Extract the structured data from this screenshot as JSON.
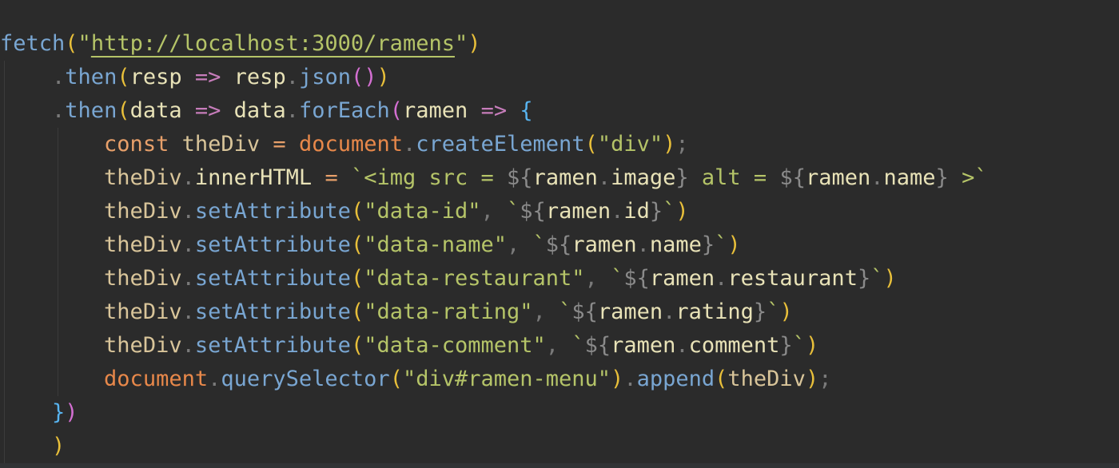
{
  "editor": {
    "background": "#2b2b2b",
    "lines": [
      [
        {
          "t": "fetch",
          "c": "#79a6d2"
        },
        {
          "t": "(",
          "c": "#e8bf3a"
        },
        {
          "t": "\"",
          "c": "#b5c468"
        },
        {
          "t": "http://localhost:3000/ramens",
          "c": "#b5c468",
          "u": true
        },
        {
          "t": "\"",
          "c": "#b5c468"
        },
        {
          "t": ")",
          "c": "#e8bf3a"
        }
      ],
      [
        {
          "t": "    ",
          "c": "#a9b7c6"
        },
        {
          "t": ".",
          "c": "#7a7a7a"
        },
        {
          "t": "then",
          "c": "#79a6d2"
        },
        {
          "t": "(",
          "c": "#e8bf3a"
        },
        {
          "t": "resp",
          "c": "#e8e2b7"
        },
        {
          "t": " ",
          "c": "#a9b7c6"
        },
        {
          "t": "=>",
          "c": "#c77dbb"
        },
        {
          "t": " ",
          "c": "#a9b7c6"
        },
        {
          "t": "resp",
          "c": "#e8e2b7"
        },
        {
          "t": ".",
          "c": "#7a7a7a"
        },
        {
          "t": "json",
          "c": "#79a6d2"
        },
        {
          "t": "()",
          "c": "#d46fd2"
        },
        {
          "t": ")",
          "c": "#e8bf3a"
        }
      ],
      [
        {
          "t": "    ",
          "c": "#a9b7c6"
        },
        {
          "t": ".",
          "c": "#7a7a7a"
        },
        {
          "t": "then",
          "c": "#79a6d2"
        },
        {
          "t": "(",
          "c": "#e8bf3a"
        },
        {
          "t": "data",
          "c": "#e8e2b7"
        },
        {
          "t": " ",
          "c": "#a9b7c6"
        },
        {
          "t": "=>",
          "c": "#c77dbb"
        },
        {
          "t": " ",
          "c": "#a9b7c6"
        },
        {
          "t": "data",
          "c": "#e8e2b7"
        },
        {
          "t": ".",
          "c": "#7a7a7a"
        },
        {
          "t": "forEach",
          "c": "#79a6d2"
        },
        {
          "t": "(",
          "c": "#d46fd2"
        },
        {
          "t": "ramen",
          "c": "#e8e2b7"
        },
        {
          "t": " ",
          "c": "#a9b7c6"
        },
        {
          "t": "=>",
          "c": "#c77dbb"
        },
        {
          "t": " ",
          "c": "#a9b7c6"
        },
        {
          "t": "{",
          "c": "#58b4f0"
        }
      ],
      [
        {
          "t": "        ",
          "c": "#a9b7c6"
        },
        {
          "t": "const",
          "c": "#e8a06a"
        },
        {
          "t": " ",
          "c": "#a9b7c6"
        },
        {
          "t": "theDiv",
          "c": "#d9c59a"
        },
        {
          "t": " ",
          "c": "#a9b7c6"
        },
        {
          "t": "=",
          "c": "#e8a06a"
        },
        {
          "t": " ",
          "c": "#a9b7c6"
        },
        {
          "t": "document",
          "c": "#e8884a"
        },
        {
          "t": ".",
          "c": "#7a7a7a"
        },
        {
          "t": "createElement",
          "c": "#79a6d2"
        },
        {
          "t": "(",
          "c": "#e8bf3a"
        },
        {
          "t": "\"div\"",
          "c": "#b5c468"
        },
        {
          "t": ")",
          "c": "#e8bf3a"
        },
        {
          "t": ";",
          "c": "#7a7a7a"
        }
      ],
      [
        {
          "t": "        ",
          "c": "#a9b7c6"
        },
        {
          "t": "theDiv",
          "c": "#d9c59a"
        },
        {
          "t": ".",
          "c": "#7a7a7a"
        },
        {
          "t": "innerHTML",
          "c": "#e8e2b7"
        },
        {
          "t": " ",
          "c": "#a9b7c6"
        },
        {
          "t": "=",
          "c": "#e8a06a"
        },
        {
          "t": " ",
          "c": "#a9b7c6"
        },
        {
          "t": "`<img src = ",
          "c": "#b5c468"
        },
        {
          "t": "${",
          "c": "#8a8a8a"
        },
        {
          "t": "ramen",
          "c": "#e8e2b7"
        },
        {
          "t": ".",
          "c": "#7a7a7a"
        },
        {
          "t": "image",
          "c": "#e8e2b7"
        },
        {
          "t": "}",
          "c": "#8a8a8a"
        },
        {
          "t": " alt = ",
          "c": "#b5c468"
        },
        {
          "t": "${",
          "c": "#8a8a8a"
        },
        {
          "t": "ramen",
          "c": "#e8e2b7"
        },
        {
          "t": ".",
          "c": "#7a7a7a"
        },
        {
          "t": "name",
          "c": "#e8e2b7"
        },
        {
          "t": "}",
          "c": "#8a8a8a"
        },
        {
          "t": " >`",
          "c": "#b5c468"
        }
      ],
      [
        {
          "t": "        ",
          "c": "#a9b7c6"
        },
        {
          "t": "theDiv",
          "c": "#d9c59a"
        },
        {
          "t": ".",
          "c": "#7a7a7a"
        },
        {
          "t": "setAttribute",
          "c": "#79a6d2"
        },
        {
          "t": "(",
          "c": "#e8bf3a"
        },
        {
          "t": "\"data-id\"",
          "c": "#b5c468"
        },
        {
          "t": ", ",
          "c": "#7a7a7a"
        },
        {
          "t": "`",
          "c": "#b5c468"
        },
        {
          "t": "${",
          "c": "#8a8a8a"
        },
        {
          "t": "ramen",
          "c": "#e8e2b7"
        },
        {
          "t": ".",
          "c": "#7a7a7a"
        },
        {
          "t": "id",
          "c": "#e8e2b7"
        },
        {
          "t": "}",
          "c": "#8a8a8a"
        },
        {
          "t": "`",
          "c": "#b5c468"
        },
        {
          "t": ")",
          "c": "#e8bf3a"
        }
      ],
      [
        {
          "t": "        ",
          "c": "#a9b7c6"
        },
        {
          "t": "theDiv",
          "c": "#d9c59a"
        },
        {
          "t": ".",
          "c": "#7a7a7a"
        },
        {
          "t": "setAttribute",
          "c": "#79a6d2"
        },
        {
          "t": "(",
          "c": "#e8bf3a"
        },
        {
          "t": "\"data-name\"",
          "c": "#b5c468"
        },
        {
          "t": ", ",
          "c": "#7a7a7a"
        },
        {
          "t": "`",
          "c": "#b5c468"
        },
        {
          "t": "${",
          "c": "#8a8a8a"
        },
        {
          "t": "ramen",
          "c": "#e8e2b7"
        },
        {
          "t": ".",
          "c": "#7a7a7a"
        },
        {
          "t": "name",
          "c": "#e8e2b7"
        },
        {
          "t": "}",
          "c": "#8a8a8a"
        },
        {
          "t": "`",
          "c": "#b5c468"
        },
        {
          "t": ")",
          "c": "#e8bf3a"
        }
      ],
      [
        {
          "t": "        ",
          "c": "#a9b7c6"
        },
        {
          "t": "theDiv",
          "c": "#d9c59a"
        },
        {
          "t": ".",
          "c": "#7a7a7a"
        },
        {
          "t": "setAttribute",
          "c": "#79a6d2"
        },
        {
          "t": "(",
          "c": "#e8bf3a"
        },
        {
          "t": "\"data-restaurant\"",
          "c": "#b5c468"
        },
        {
          "t": ", ",
          "c": "#7a7a7a"
        },
        {
          "t": "`",
          "c": "#b5c468"
        },
        {
          "t": "${",
          "c": "#8a8a8a"
        },
        {
          "t": "ramen",
          "c": "#e8e2b7"
        },
        {
          "t": ".",
          "c": "#7a7a7a"
        },
        {
          "t": "restaurant",
          "c": "#e8e2b7"
        },
        {
          "t": "}",
          "c": "#8a8a8a"
        },
        {
          "t": "`",
          "c": "#b5c468"
        },
        {
          "t": ")",
          "c": "#e8bf3a"
        }
      ],
      [
        {
          "t": "        ",
          "c": "#a9b7c6"
        },
        {
          "t": "theDiv",
          "c": "#d9c59a"
        },
        {
          "t": ".",
          "c": "#7a7a7a"
        },
        {
          "t": "setAttribute",
          "c": "#79a6d2"
        },
        {
          "t": "(",
          "c": "#e8bf3a"
        },
        {
          "t": "\"data-rating\"",
          "c": "#b5c468"
        },
        {
          "t": ", ",
          "c": "#7a7a7a"
        },
        {
          "t": "`",
          "c": "#b5c468"
        },
        {
          "t": "${",
          "c": "#8a8a8a"
        },
        {
          "t": "ramen",
          "c": "#e8e2b7"
        },
        {
          "t": ".",
          "c": "#7a7a7a"
        },
        {
          "t": "rating",
          "c": "#e8e2b7"
        },
        {
          "t": "}",
          "c": "#8a8a8a"
        },
        {
          "t": "`",
          "c": "#b5c468"
        },
        {
          "t": ")",
          "c": "#e8bf3a"
        }
      ],
      [
        {
          "t": "        ",
          "c": "#a9b7c6"
        },
        {
          "t": "theDiv",
          "c": "#d9c59a"
        },
        {
          "t": ".",
          "c": "#7a7a7a"
        },
        {
          "t": "setAttribute",
          "c": "#79a6d2"
        },
        {
          "t": "(",
          "c": "#e8bf3a"
        },
        {
          "t": "\"data-comment\"",
          "c": "#b5c468"
        },
        {
          "t": ", ",
          "c": "#7a7a7a"
        },
        {
          "t": "`",
          "c": "#b5c468"
        },
        {
          "t": "${",
          "c": "#8a8a8a"
        },
        {
          "t": "ramen",
          "c": "#e8e2b7"
        },
        {
          "t": ".",
          "c": "#7a7a7a"
        },
        {
          "t": "comment",
          "c": "#e8e2b7"
        },
        {
          "t": "}",
          "c": "#8a8a8a"
        },
        {
          "t": "`",
          "c": "#b5c468"
        },
        {
          "t": ")",
          "c": "#e8bf3a"
        }
      ],
      [
        {
          "t": "        ",
          "c": "#a9b7c6"
        },
        {
          "t": "document",
          "c": "#e8884a"
        },
        {
          "t": ".",
          "c": "#7a7a7a"
        },
        {
          "t": "querySelector",
          "c": "#79a6d2"
        },
        {
          "t": "(",
          "c": "#e8bf3a"
        },
        {
          "t": "\"div#ramen-menu\"",
          "c": "#b5c468"
        },
        {
          "t": ")",
          "c": "#e8bf3a"
        },
        {
          "t": ".",
          "c": "#7a7a7a"
        },
        {
          "t": "append",
          "c": "#79a6d2"
        },
        {
          "t": "(",
          "c": "#e8bf3a"
        },
        {
          "t": "theDiv",
          "c": "#d9c59a"
        },
        {
          "t": ")",
          "c": "#e8bf3a"
        },
        {
          "t": ";",
          "c": "#7a7a7a"
        }
      ],
      [
        {
          "t": "    ",
          "c": "#a9b7c6"
        },
        {
          "t": "}",
          "c": "#58b4f0"
        },
        {
          "t": ")",
          "c": "#d46fd2"
        }
      ],
      [
        {
          "t": "    ",
          "c": "#a9b7c6"
        },
        {
          "t": ")",
          "c": "#e8bf3a"
        }
      ]
    ]
  }
}
